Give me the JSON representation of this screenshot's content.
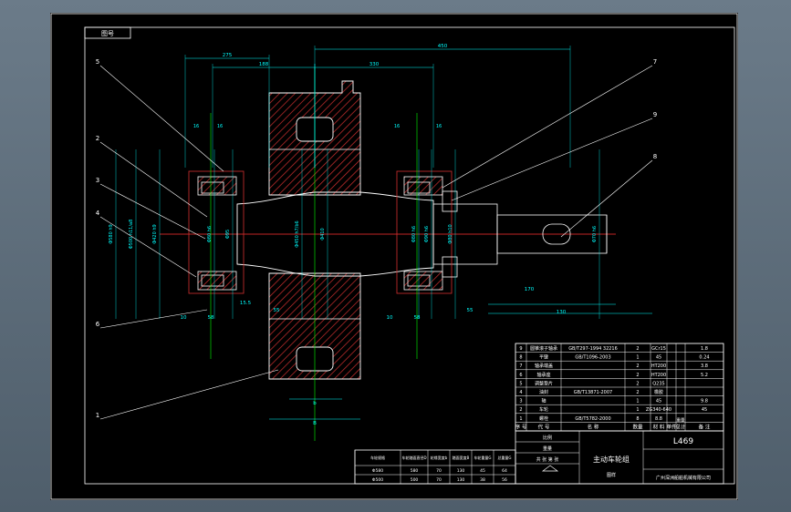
{
  "drawing": {
    "corner_tag": "图号",
    "dims_top": [
      "275",
      "188",
      "330",
      "450"
    ],
    "dims_bearing_left": [
      "16",
      "16"
    ],
    "dims_bearing_right": [
      "16",
      "16"
    ],
    "dims_vertical": [
      "Φ580 h9",
      "Φ500 h11/a8",
      "Φ420 h9",
      "Φ80 h6",
      "Φ95",
      "Φ450 h7/b6",
      "Φ410",
      "Φ80 h6",
      "Φ90 h6",
      "Φ80 h10",
      "Φ70 h6"
    ],
    "dims_bottom": [
      "10",
      "58",
      "15.5",
      "55",
      "10",
      "58",
      "55",
      "170",
      "130",
      "b",
      "B"
    ],
    "callouts": [
      "5",
      "2",
      "3",
      "4",
      "6",
      "1",
      "7",
      "9",
      "8"
    ]
  },
  "bom": {
    "rows": [
      [
        "9",
        "圆锥滚子轴承",
        "GB/T297-1994 32216",
        "2",
        "GCr15",
        "",
        "",
        "1.8"
      ],
      [
        "8",
        "平键",
        "GB/T1096-2003",
        "1",
        "45",
        "",
        "",
        "0.24"
      ],
      [
        "7",
        "轴承端盖",
        "",
        "2",
        "HT200",
        "",
        "",
        "3.8"
      ],
      [
        "6",
        "轴承座",
        "",
        "2",
        "HT200",
        "",
        "",
        "5.2"
      ],
      [
        "5",
        "调整垫片",
        "",
        "2",
        "Q235",
        "",
        "",
        ""
      ],
      [
        "4",
        "油封",
        "GB/T13871-2007",
        "2",
        "橡胶",
        "",
        "",
        ""
      ],
      [
        "3",
        "轴",
        "",
        "1",
        "45",
        "",
        "",
        "9.8"
      ],
      [
        "2",
        "车轮",
        "",
        "1",
        "ZG340-640",
        "",
        "",
        "45"
      ],
      [
        "1",
        "螺栓",
        "GB/T5782-2000",
        "8",
        "8.8",
        "",
        "",
        ""
      ]
    ],
    "header": [
      "序 号",
      "代 号",
      "名 称",
      "数量",
      "材 料",
      "单件",
      "总计",
      "备 注"
    ],
    "header_weight": "重量"
  },
  "spec_table": {
    "headers": [
      "车轮规格",
      "车轮踏面直径D",
      "轮缘宽度b",
      "踏面宽度B",
      "车轮重量G",
      "总重量G"
    ],
    "rows": [
      [
        "Φ580",
        "580",
        "70",
        "130",
        "45",
        "64"
      ],
      [
        "Φ500",
        "500",
        "70",
        "130",
        "38",
        "56"
      ]
    ]
  },
  "title_block": {
    "name": "主动车轮组",
    "drawing_no": "L469",
    "company": "广州深洲船舶机械有限公司",
    "scale_label": "比例",
    "mass_label": "重量",
    "sheet_label": "共 张 第 张",
    "material": "图样"
  },
  "colors": {
    "background": "#000000",
    "geometry": "#ffffff",
    "section_hatch": "#d13030",
    "dimension": "#00ffff",
    "centerline": "#ff3030",
    "green": "#00ff00",
    "callout": "#ffffff"
  }
}
